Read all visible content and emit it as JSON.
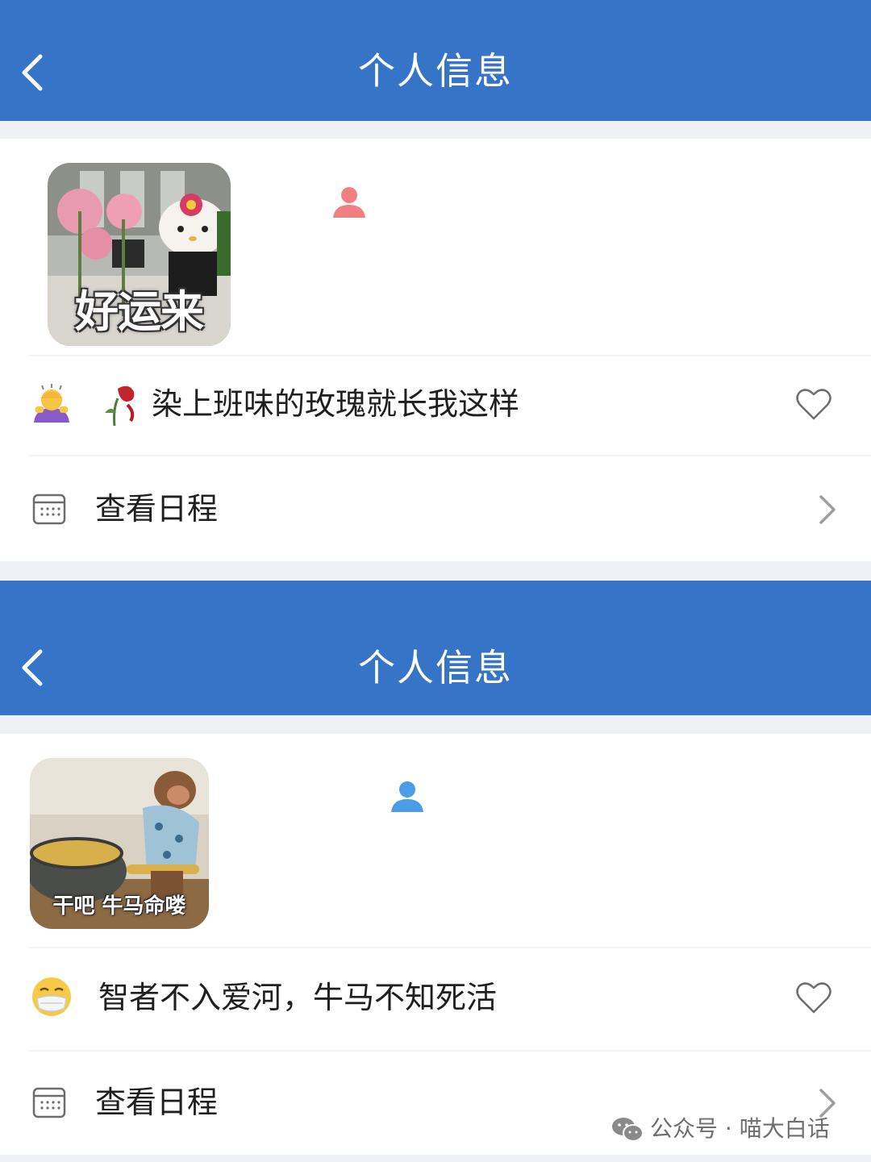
{
  "panels": [
    {
      "header": {
        "title": "个人信息"
      },
      "avatar": {
        "caption": "好运来",
        "person_icon_color": "#f08080"
      },
      "status": {
        "emoji": "🙆‍♀️ 🥀",
        "text": "染上班味的玫瑰就长我这样"
      },
      "schedule": {
        "label": "查看日程"
      }
    },
    {
      "header": {
        "title": "个人信息"
      },
      "avatar": {
        "caption": "干吧 牛马命喽",
        "person_icon_color": "#4a9de6"
      },
      "status": {
        "emoji": "😷",
        "text": "智者不入爱河，牛马不知死活"
      },
      "schedule": {
        "label": "查看日程"
      }
    }
  ],
  "watermark": {
    "text": "公众号 · 喵大白话"
  },
  "colors": {
    "header_bg": "#3574c7",
    "page_bg": "#eef0f3",
    "card_bg": "#ffffff"
  }
}
